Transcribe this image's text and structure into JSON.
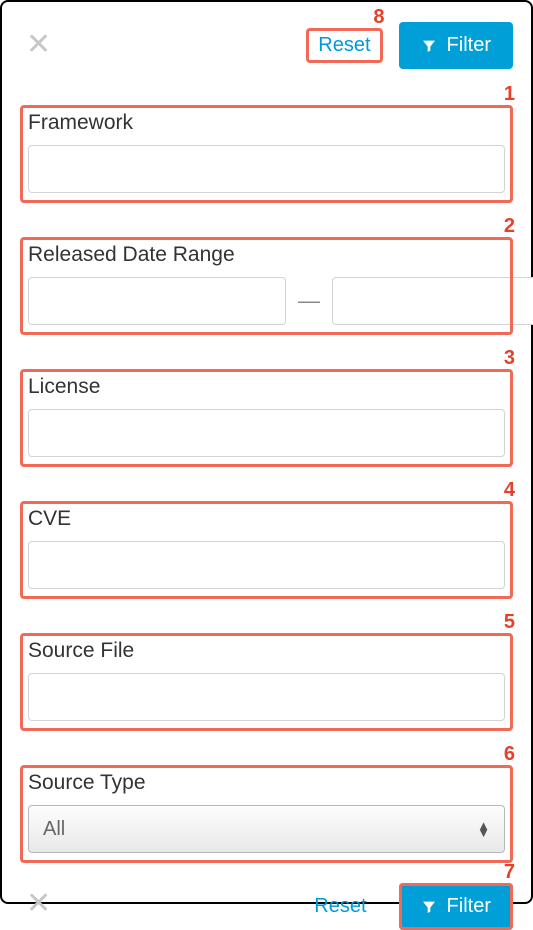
{
  "header": {
    "reset_label": "Reset",
    "filter_label": "Filter"
  },
  "fields": {
    "framework": {
      "label": "Framework",
      "value": ""
    },
    "released": {
      "label": "Released Date Range",
      "from": "",
      "to": "",
      "separator": "—"
    },
    "license": {
      "label": "License",
      "value": ""
    },
    "cve": {
      "label": "CVE",
      "value": ""
    },
    "source_file": {
      "label": "Source File",
      "value": ""
    },
    "source_type": {
      "label": "Source Type",
      "selected": "All"
    }
  },
  "footer": {
    "reset_label": "Reset",
    "filter_label": "Filter"
  },
  "annotations": {
    "n1": "1",
    "n2": "2",
    "n3": "3",
    "n4": "4",
    "n5": "5",
    "n6": "6",
    "n7": "7",
    "n8": "8"
  }
}
